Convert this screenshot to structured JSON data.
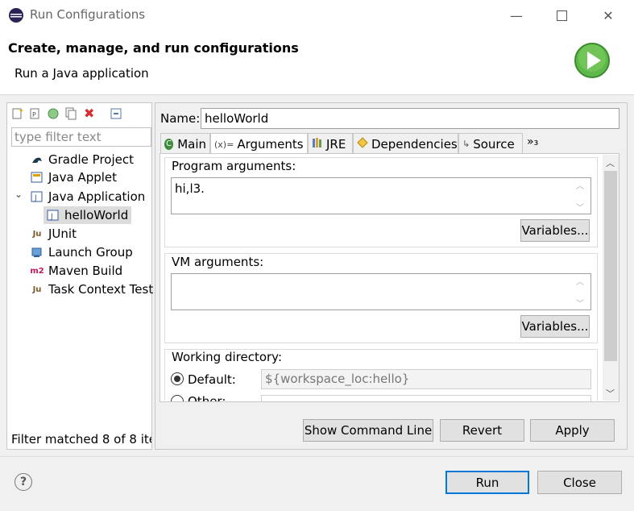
{
  "window": {
    "title": "Run Configurations",
    "minimize_icon": "minimize-icon",
    "maximize_icon": "maximize-icon",
    "close_icon": "close-icon"
  },
  "header": {
    "title": "Create, manage, and run configurations",
    "subtitle": "Run a Java application",
    "icon": "run-icon"
  },
  "left": {
    "toolbar": [
      "new-configuration-icon",
      "new-prototype-icon",
      "export-icon",
      "duplicate-icon",
      "delete-icon",
      "collapse-all-icon"
    ],
    "filter_placeholder": "type filter text",
    "tree": [
      {
        "label": "Gradle Project",
        "icon": "gradle-icon"
      },
      {
        "label": "Java Applet",
        "icon": "java-applet-icon"
      },
      {
        "label": "Java Application",
        "icon": "java-application-icon",
        "expanded": true
      },
      {
        "label": "helloWorld",
        "icon": "java-application-icon",
        "selected": true
      },
      {
        "label": "JUnit",
        "icon": "junit-icon"
      },
      {
        "label": "Launch Group",
        "icon": "launch-group-icon"
      },
      {
        "label": "Maven Build",
        "icon": "maven-icon"
      },
      {
        "label": "Task Context Test",
        "icon": "task-context-icon"
      }
    ],
    "status": "Filter matched 8 of 8 ite"
  },
  "right": {
    "name_label": "Name:",
    "name_value": "helloWorld",
    "tabs": [
      {
        "label": "Main",
        "icon": "main-tab-icon"
      },
      {
        "label": "Arguments",
        "icon": "arguments-tab-icon",
        "active": true
      },
      {
        "label": "JRE",
        "icon": "jre-tab-icon"
      },
      {
        "label": "Dependencies",
        "icon": "dependencies-tab-icon"
      },
      {
        "label": "Source",
        "icon": "source-tab-icon"
      },
      {
        "label": "»₃",
        "icon": "more-tabs-icon"
      }
    ],
    "program_args": {
      "label": "Program arguments:",
      "value": "hi,l3.",
      "variables": "Variables..."
    },
    "vm_args": {
      "label": "VM arguments:",
      "value": "",
      "variables": "Variables..."
    },
    "working_dir": {
      "label": "Working directory:",
      "default_label": "Default:",
      "default_value": "${workspace_loc:hello}",
      "other_label": "Other:"
    },
    "buttons": {
      "show_command_line": "Show Command Line",
      "revert": "Revert",
      "apply": "Apply"
    }
  },
  "footer": {
    "run": "Run",
    "close": "Close",
    "help_icon": "help-icon",
    "help_glyph": "?"
  },
  "colors": {
    "accent": "#0078d7",
    "run_green": "#4caf50"
  }
}
